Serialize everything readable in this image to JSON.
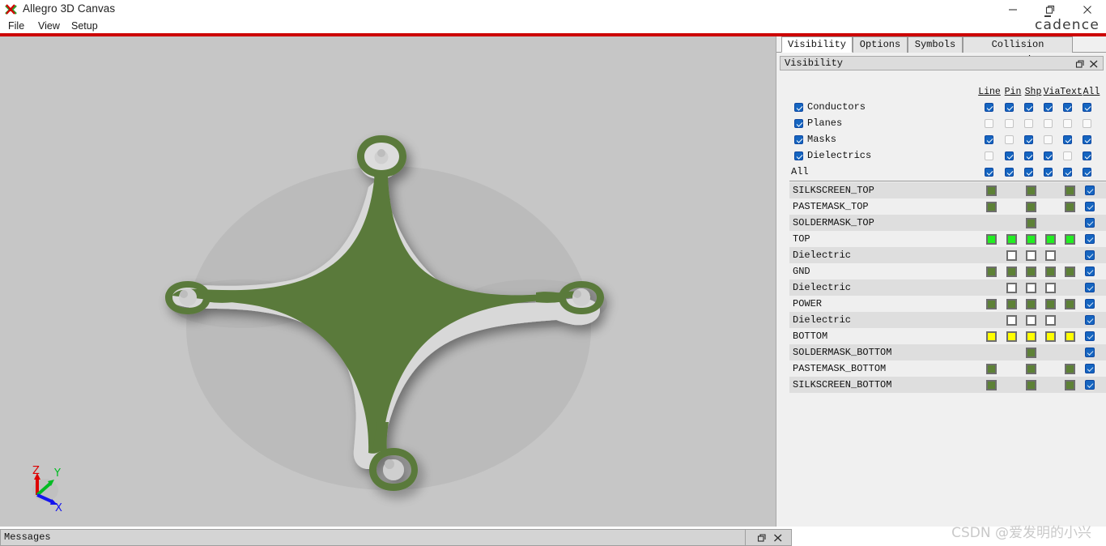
{
  "window": {
    "title": "Allegro 3D Canvas",
    "app_icon": "allegro-icon",
    "minimize_label": "—",
    "maximize_label": "❐",
    "close_label": "✕",
    "brand": "cadence",
    "accent_color": "#cc0000"
  },
  "menubar": {
    "items": [
      {
        "label": "File"
      },
      {
        "label": "View"
      },
      {
        "label": "Setup"
      }
    ]
  },
  "canvas": {
    "background_color": "#c6c6c6",
    "pcb_color": "#5a7a3a",
    "pcb_edge_color": "#d8d8d8",
    "shape_name": "quadcopter-frame-pcb",
    "axis_gizmo": {
      "z_label": "Z",
      "z_color": "#dd0000",
      "y_label": "Y",
      "y_color": "#00bb22",
      "x_label": "X",
      "x_color": "#1414ee"
    }
  },
  "panel": {
    "tabs": [
      {
        "label": "Visibility",
        "active": true
      },
      {
        "label": "Options",
        "active": false
      },
      {
        "label": "Symbols",
        "active": false
      },
      {
        "label": "Collision Detection",
        "active": false
      }
    ],
    "header": {
      "title": "Visibility",
      "restore_label": "❐",
      "close_label": "✕"
    },
    "columns": [
      "Line",
      "Pin",
      "Shp",
      "Via",
      "Text",
      "All"
    ],
    "classes": [
      {
        "label": "Conductors",
        "enabled": true,
        "cells": [
          true,
          true,
          true,
          true,
          true,
          true
        ]
      },
      {
        "label": "Planes",
        "enabled": true,
        "cells": [
          false,
          false,
          false,
          false,
          false,
          false
        ]
      },
      {
        "label": "Masks",
        "enabled": true,
        "cells": [
          true,
          false,
          true,
          false,
          true,
          true
        ]
      },
      {
        "label": "Dielectrics",
        "enabled": true,
        "cells": [
          false,
          true,
          true,
          true,
          false,
          true
        ]
      },
      {
        "label": "All",
        "enabled": null,
        "cells": [
          true,
          true,
          true,
          true,
          true,
          true
        ]
      }
    ],
    "layers": [
      {
        "name": "SILKSCREEN_TOP",
        "swatches": [
          "#5d8136",
          null,
          "#5d8136",
          null,
          "#5d8136"
        ],
        "visible": true
      },
      {
        "name": "PASTEMASK_TOP",
        "swatches": [
          "#5d8136",
          null,
          "#5d8136",
          null,
          "#5d8136"
        ],
        "visible": true
      },
      {
        "name": "SOLDERMASK_TOP",
        "swatches": [
          null,
          null,
          "#5d8136",
          null,
          null
        ],
        "visible": true
      },
      {
        "name": "TOP",
        "swatches": [
          "#22ee22",
          "#22ee22",
          "#22ee22",
          "#22ee22",
          "#22ee22"
        ],
        "visible": true
      },
      {
        "name": "Dielectric",
        "swatches": [
          null,
          "#ffffff",
          "#ffffff",
          "#ffffff",
          null
        ],
        "visible": true
      },
      {
        "name": "GND",
        "swatches": [
          "#5d8136",
          "#5d8136",
          "#5d8136",
          "#5d8136",
          "#5d8136"
        ],
        "visible": true
      },
      {
        "name": "Dielectric",
        "swatches": [
          null,
          "#ffffff",
          "#ffffff",
          "#ffffff",
          null
        ],
        "visible": true
      },
      {
        "name": "POWER",
        "swatches": [
          "#5d8136",
          "#5d8136",
          "#5d8136",
          "#5d8136",
          "#5d8136"
        ],
        "visible": true
      },
      {
        "name": "Dielectric",
        "swatches": [
          null,
          "#ffffff",
          "#ffffff",
          "#ffffff",
          null
        ],
        "visible": true
      },
      {
        "name": "BOTTOM",
        "swatches": [
          "#ffff00",
          "#ffff00",
          "#ffff00",
          "#ffff00",
          "#ffff00"
        ],
        "visible": true
      },
      {
        "name": "SOLDERMASK_BOTTOM",
        "swatches": [
          null,
          null,
          "#5d8136",
          null,
          null
        ],
        "visible": true
      },
      {
        "name": "PASTEMASK_BOTTOM",
        "swatches": [
          "#5d8136",
          null,
          "#5d8136",
          null,
          "#5d8136"
        ],
        "visible": true
      },
      {
        "name": "SILKSCREEN_BOTTOM",
        "swatches": [
          "#5d8136",
          null,
          "#5d8136",
          null,
          "#5d8136"
        ],
        "visible": true
      }
    ]
  },
  "statusbar": {
    "messages_label": "Messages",
    "restore_label": "❐",
    "close_label": "✕"
  },
  "watermark": {
    "text": "CSDN @爱发明的小兴"
  }
}
